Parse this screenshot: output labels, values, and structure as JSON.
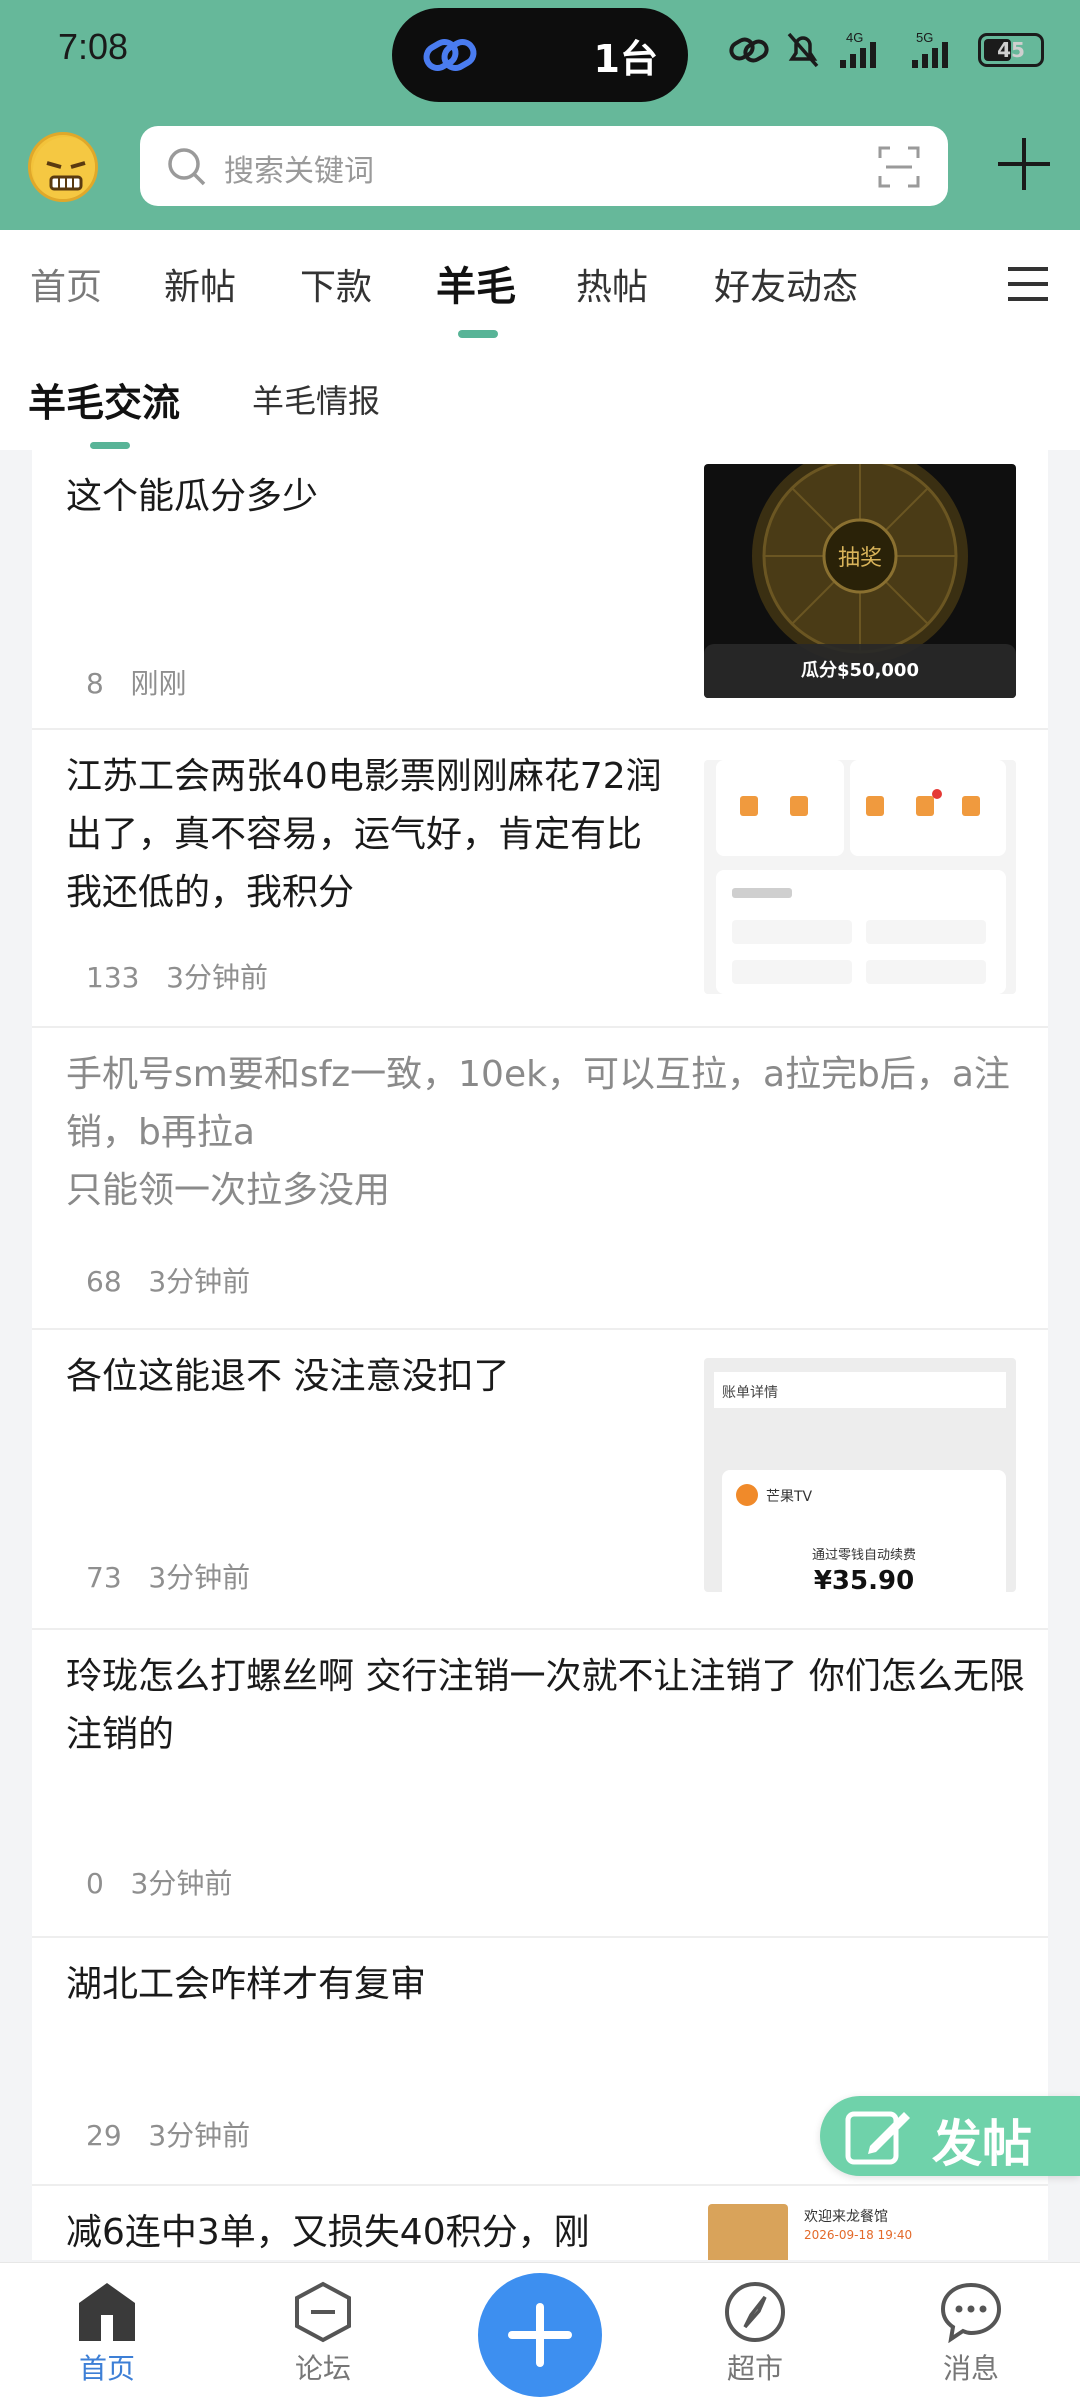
{
  "status_bar": {
    "time": "7:08",
    "island_text": "1台",
    "battery": "45",
    "net_1": "4G",
    "net_2": "5G"
  },
  "header": {
    "search_placeholder": "搜索关键词"
  },
  "tabs": [
    {
      "label": "首页"
    },
    {
      "label": "新帖"
    },
    {
      "label": "下款"
    },
    {
      "label": "羊毛",
      "active": true
    },
    {
      "label": "热帖"
    },
    {
      "label": "好友动态"
    }
  ],
  "subtabs": [
    {
      "label": "羊毛交流",
      "active": true
    },
    {
      "label": "羊毛情报"
    }
  ],
  "posts": [
    {
      "title": "这个能瓜分多少",
      "count": "8",
      "time": "刚刚",
      "thumb_caption": "瓜分$50,000",
      "thumb_wheel_center": "抽奖"
    },
    {
      "title": "江苏工会两张40电影票刚刚麻花72润出了，真不容易，运气好，肯定有比我还低的，我积分",
      "count": "133",
      "time": "3分钟前"
    },
    {
      "title": "手机号sm要和sfz一致，10ek，可以互拉，a拉完b后，a注销，b再拉a\n只能领一次拉多没用",
      "count": "68",
      "time": "3分钟前"
    },
    {
      "title": "各位这能退不 没注意没扣了",
      "count": "73",
      "time": "3分钟前",
      "thumb_brand": "芒果TV",
      "thumb_line": "通过零钱自动续费",
      "thumb_price": "¥35.90",
      "thumb_detail": "账单详情"
    },
    {
      "title": "玲珑怎么打螺丝啊 交行注销一次就不让注销了 你们怎么无限注销的",
      "count": "0",
      "time": "3分钟前"
    },
    {
      "title": "湖北工会咋样才有复审",
      "count": "29",
      "time": "3分钟前"
    },
    {
      "title": "减6连中3单，又损失40积分，刚",
      "count": "",
      "time": "",
      "thumb_title": "欢迎来龙餐馆",
      "thumb_date": "2026-09-18 19:40"
    }
  ],
  "fab": {
    "label": "发帖"
  },
  "bottom_nav": [
    {
      "label": "首页",
      "active": true
    },
    {
      "label": "论坛"
    },
    {
      "label": "超市"
    },
    {
      "label": "消息"
    }
  ],
  "colors": {
    "brand_green": "#66b89a",
    "accent_blue": "#3d8ff0"
  }
}
